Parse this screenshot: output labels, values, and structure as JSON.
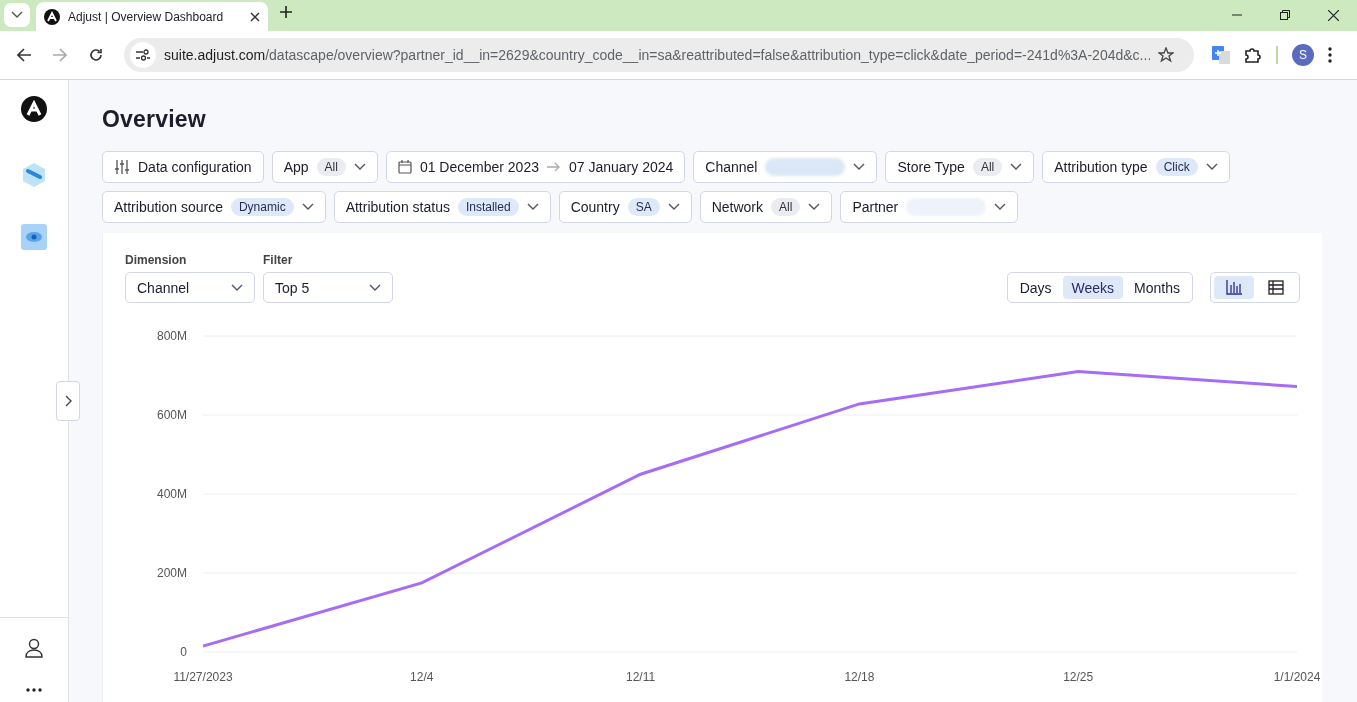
{
  "browser": {
    "tab_title": "Adjust | Overview Dashboard",
    "url_host": "suite.adjust.com",
    "url_path": "/datascape/overview?partner_id__in=2629&country_code__in=sa&reattributed=false&attribution_type=click&date_period=-241d%3A-204d&c...",
    "profile_initial": "S"
  },
  "page": {
    "title": "Overview"
  },
  "filter_rows": [
    [
      {
        "kind": "config",
        "label": "Data configuration"
      },
      {
        "kind": "neutral",
        "label": "App",
        "value": "All"
      },
      {
        "kind": "date",
        "start": "01 December 2023",
        "end": "07 January 2024"
      },
      {
        "kind": "redacted_accent",
        "label": "Channel"
      },
      {
        "kind": "neutral",
        "label": "Store Type",
        "value": "All"
      },
      {
        "kind": "accent",
        "label": "Attribution type",
        "value": "Click"
      }
    ],
    [
      {
        "kind": "accent",
        "label": "Attribution source",
        "value": "Dynamic"
      },
      {
        "kind": "accent",
        "label": "Attribution status",
        "value": "Installed"
      },
      {
        "kind": "accent",
        "label": "Country",
        "value": "SA"
      },
      {
        "kind": "neutral",
        "label": "Network",
        "value": "All"
      },
      {
        "kind": "redacted_plain",
        "label": "Partner"
      }
    ]
  ],
  "controls": {
    "dimension": {
      "label": "Dimension",
      "value": "Channel"
    },
    "filter": {
      "label": "Filter",
      "value": "Top 5"
    },
    "periods": [
      {
        "label": "Days",
        "selected": false
      },
      {
        "label": "Weeks",
        "selected": true
      },
      {
        "label": "Months",
        "selected": false
      }
    ],
    "views": [
      {
        "kind": "chart",
        "selected": true
      },
      {
        "kind": "table",
        "selected": false
      }
    ]
  },
  "chart_data": {
    "type": "line",
    "categories": [
      "11/27/2023",
      "12/4",
      "12/11",
      "12/18",
      "12/25",
      "1/1/2024"
    ],
    "series": [
      {
        "color": "#a66cf5",
        "values": [
          15,
          175,
          450,
          628,
          710,
          672
        ]
      }
    ],
    "grid": true,
    "ylim": [
      0,
      800
    ],
    "yticks": [
      {
        "value": 0,
        "label": "0"
      },
      {
        "value": 200,
        "label": "200M"
      },
      {
        "value": 400,
        "label": "400M"
      },
      {
        "value": 600,
        "label": "600M"
      },
      {
        "value": 800,
        "label": "800M"
      }
    ]
  }
}
